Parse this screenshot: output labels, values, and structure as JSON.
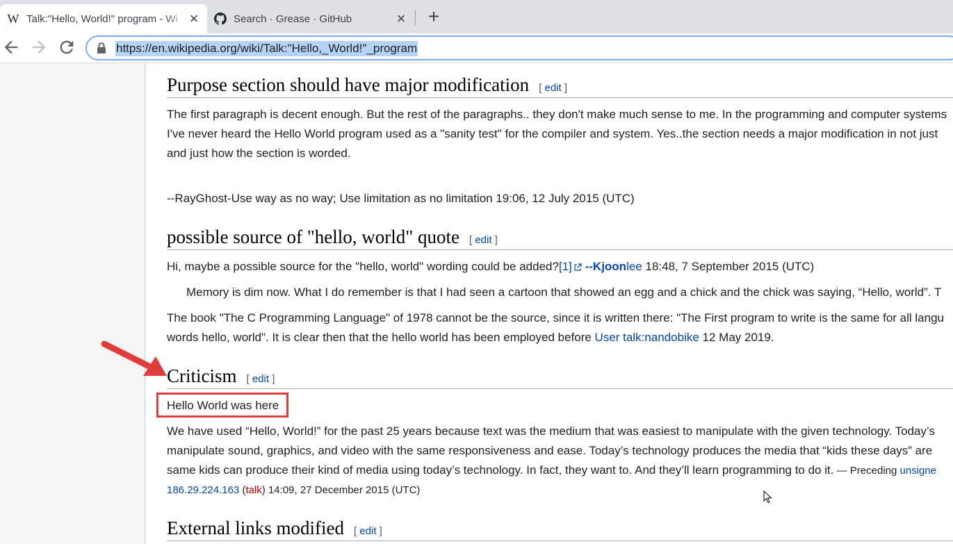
{
  "browser": {
    "tabs": [
      {
        "title": "Talk:\"Hello, World!\" program - Wi",
        "favicon": "W",
        "active": true
      },
      {
        "title": "Search · Grease · GitHub",
        "favicon": "github-icon",
        "active": false
      }
    ],
    "new_tab_label": "+",
    "close_label": "×",
    "url": "https://en.wikipedia.org/wiki/Talk:\"Hello,_World!\"_program"
  },
  "page": {
    "sections": [
      {
        "heading": "Purpose section should have major modification",
        "edit": "edit",
        "lines": [
          "The first paragraph is decent enough. But the rest of the paragraphs.. they don't make much sense to me. In the programming and computer systems",
          "I've never heard the Hello World program used as a \"sanity test\" for the compiler and system. Yes..the section needs a major modification in not just",
          "and just how the section is worded.",
          "--RayGhost-Use way as no way; Use limitation as no limitation 19:06, 12 July 2015 (UTC)"
        ]
      },
      {
        "heading": "possible source of \"hello, world\" quote",
        "edit": "edit",
        "line1_pre": "Hi, maybe a possible source for the \"hello, world\" wording could be added?",
        "line1_ref": "[1]",
        "line1_user": "--Kjoon",
        "line1_user2": "lee",
        "line1_post": " 18:48, 7 September 2015 (UTC)",
        "line2": "Memory is dim now. What I do remember is that I had seen a cartoon that showed an egg and a chick and the chick was saying, “Hello, world”. T",
        "line3": "The book \"The C Programming Language\" of 1978 cannot be the source, since it is written there: \"The First program to write is the same for all langu",
        "line4_pre": "words hello, world\". It is clear then that the hello world has been employed before ",
        "line4_link": "User talk:nandobike",
        "line4_post": " 12 May 2019."
      },
      {
        "heading": "Criticism",
        "edit": "edit",
        "highlight": "Hello World was here",
        "lines": [
          "We have used “Hello, World!” for the past 25 years because text was the medium that was easiest to manipulate with the given technology. Today’s",
          "manipulate sound, graphics, and video with the same responsiveness and ease. Today’s technology produces the media that “kids these days” are",
          "same kids can produce their kind of media using today’s technology. In fact, they want to. And they’ll learn programming to do it."
        ],
        "preceding": " — Preceding ",
        "unsigned": "unsigne",
        "ip": "186.29.224.163",
        "talk": "talk",
        "sig_post": " 14:09, 27 December 2015 (UTC)"
      },
      {
        "heading": "External links modified",
        "edit": "edit"
      }
    ]
  },
  "colors": {
    "annotation": "#e03c3c",
    "link": "#0645ad"
  }
}
